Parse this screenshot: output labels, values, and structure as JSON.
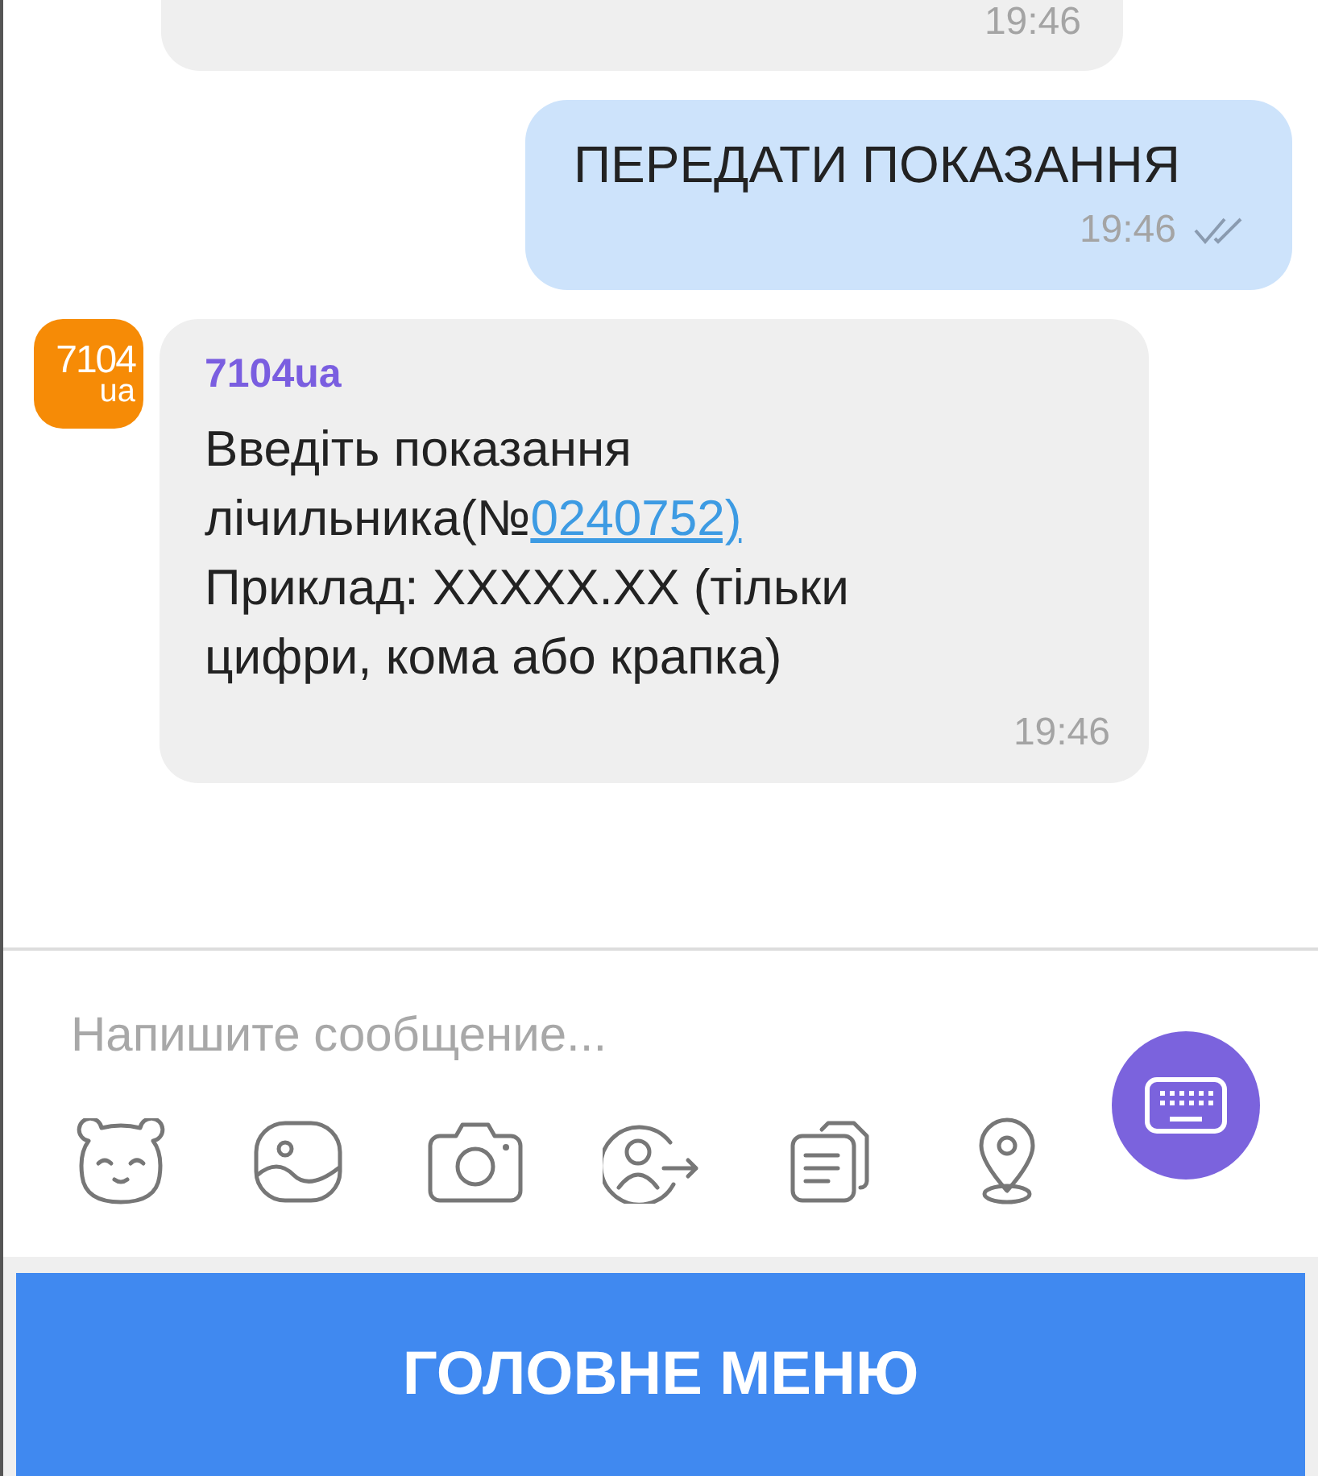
{
  "messages": [
    {
      "kind": "incoming_cut",
      "time": "19:46"
    },
    {
      "kind": "outgoing",
      "text": "ПЕРЕДАТИ ПОКАЗАННЯ",
      "time": "19:46",
      "delivered": true
    },
    {
      "kind": "incoming",
      "sender": "7104ua",
      "avatar": {
        "line_1": "7104",
        "line_2": "ua"
      },
      "text_before": "Введіть показання лічильника(№",
      "link": "0240752)",
      "text_after": "Приклад: XXXXX.XX (тільки цифри, кома або крапка)",
      "time": "19:46"
    }
  ],
  "composer": {
    "placeholder": "Напишите сообщение...",
    "tools": [
      {
        "kind": "sticker"
      },
      {
        "kind": "gallery"
      },
      {
        "kind": "camera"
      },
      {
        "kind": "share_contact"
      },
      {
        "kind": "files"
      },
      {
        "kind": "location"
      }
    ]
  },
  "main_button": "ГОЛОВНЕ МЕНЮ"
}
